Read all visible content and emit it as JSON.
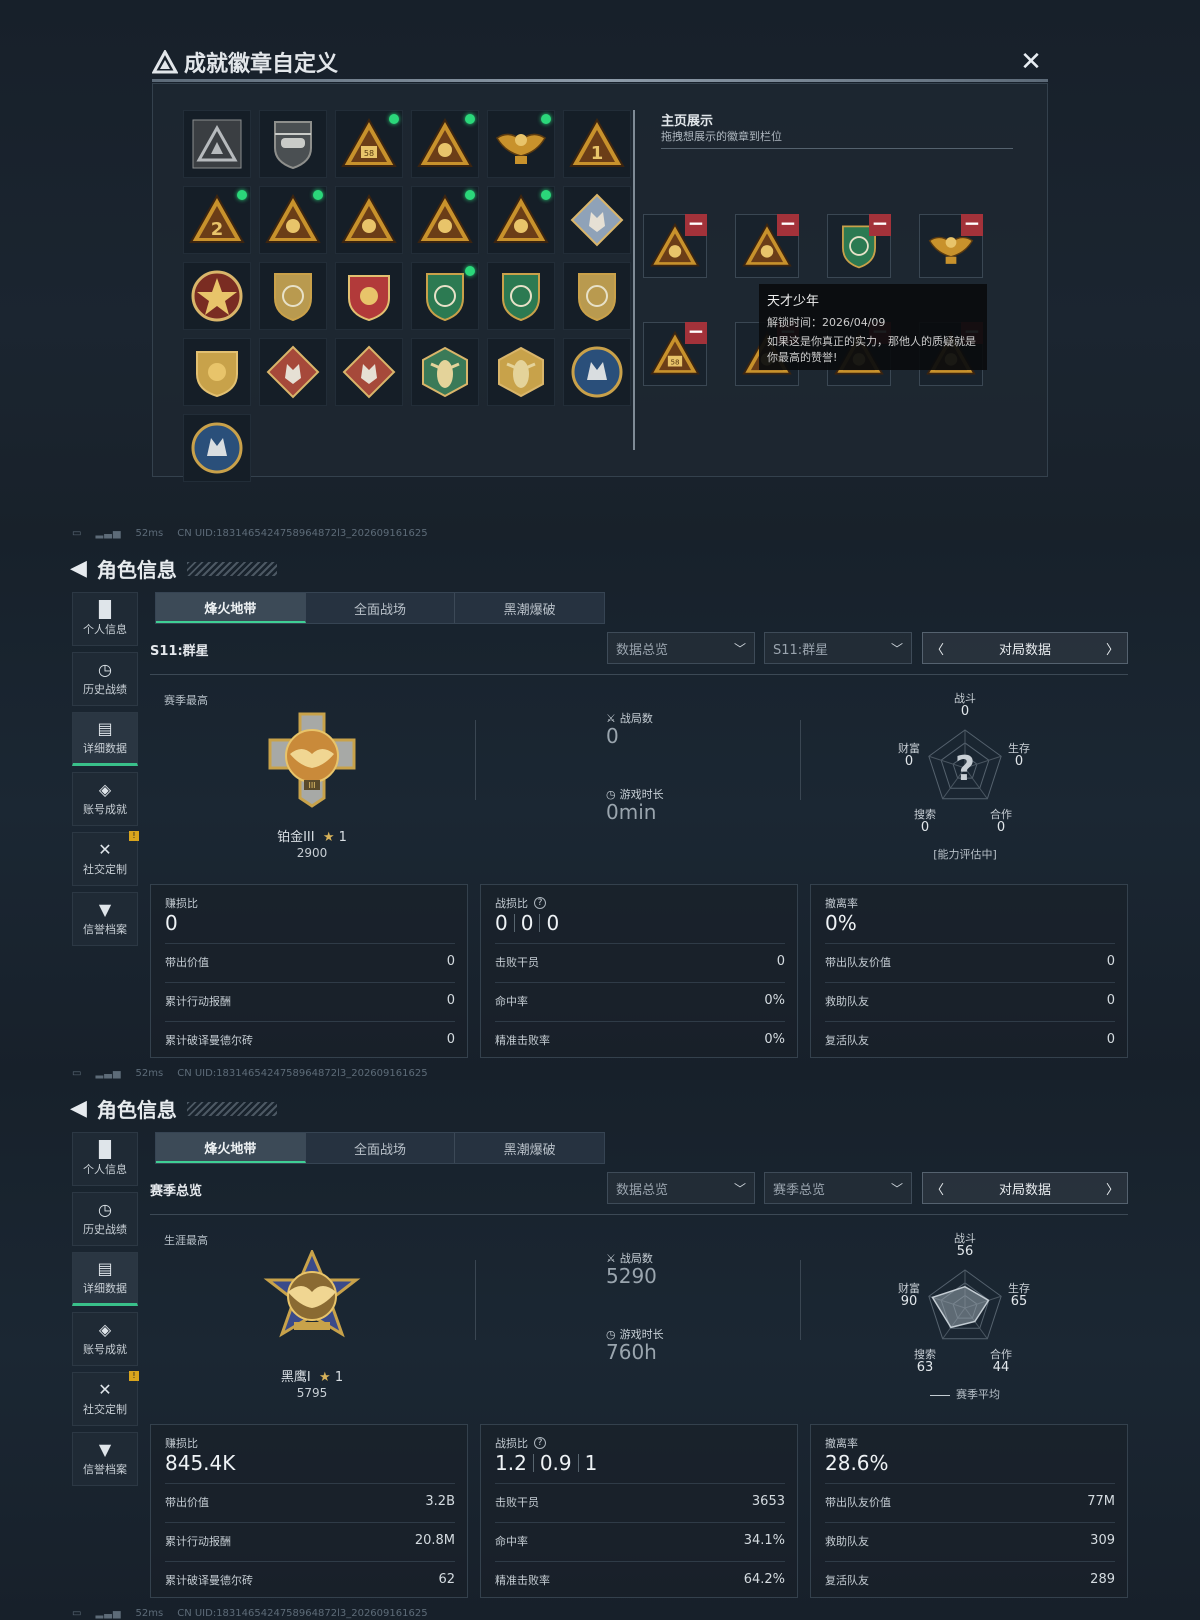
{
  "dialog": {
    "title": "成就徽章自定义",
    "close_icon": "close-icon",
    "showcase_title": "主页展示",
    "showcase_sub": "拖拽想展示的徽章到栏位",
    "badges": [
      {
        "icon": "tri-eye-badge-icon",
        "new": false,
        "color": "#8a8d8f"
      },
      {
        "icon": "helicopter-badge-icon",
        "new": false,
        "color": "#8e8f8c"
      },
      {
        "icon": "tri-58-badge-icon",
        "new": true,
        "color": "#c8922c"
      },
      {
        "icon": "tri-skull-badge-icon",
        "new": true,
        "color": "#c8922c"
      },
      {
        "icon": "eagle-badge-icon",
        "new": true,
        "color": "#c8922c"
      },
      {
        "icon": "tri-1-badge-icon",
        "new": false,
        "color": "#c8922c"
      },
      {
        "icon": "tri-2-badge-icon",
        "new": true,
        "color": "#c8922c"
      },
      {
        "icon": "tri-box-badge-icon",
        "new": true,
        "color": "#c8922c"
      },
      {
        "icon": "tri-soldier-badge-icon",
        "new": false,
        "color": "#c8922c"
      },
      {
        "icon": "tri-rocket-badge-icon",
        "new": true,
        "color": "#c8922c"
      },
      {
        "icon": "tri-wolf-badge-icon",
        "new": true,
        "color": "#c8922c"
      },
      {
        "icon": "diamond-cube-badge-icon",
        "new": false,
        "color": "#8fa2b8"
      },
      {
        "icon": "star-wreath-badge-icon",
        "new": false,
        "color": "#b94a32"
      },
      {
        "icon": "shield-emblem-badge-icon",
        "new": false,
        "color": "#b99a4f"
      },
      {
        "icon": "crest-badge-icon",
        "new": false,
        "color": "#b23a3a"
      },
      {
        "icon": "green-shield-badge-icon",
        "new": true,
        "color": "#2c7a52"
      },
      {
        "icon": "green-rifle-badge-icon",
        "new": false,
        "color": "#2c7a52"
      },
      {
        "icon": "gun-shield-badge-icon",
        "new": false,
        "color": "#b99a4f"
      },
      {
        "icon": "winged-crest-badge-icon",
        "new": false,
        "color": "#c8a24a"
      },
      {
        "icon": "wolf-diamond-badge-icon",
        "new": false,
        "color": "#a6493a"
      },
      {
        "icon": "wolf-diamond2-badge-icon",
        "new": false,
        "color": "#a6493a"
      },
      {
        "icon": "wasp-badge-icon",
        "new": false,
        "color": "#3a7a58"
      },
      {
        "icon": "wasp2-badge-icon",
        "new": false,
        "color": "#c8a24a"
      },
      {
        "icon": "wolf-circle-badge-icon",
        "new": false,
        "color": "#2a4f7a"
      },
      {
        "icon": "wolf-circle2-badge-icon",
        "new": false,
        "color": "#2a4f7a"
      }
    ],
    "slots": [
      {
        "icon": "tri-rocket-badge-icon",
        "color": "#c8922c"
      },
      {
        "icon": "tri-box-badge-icon",
        "color": "#c8922c"
      },
      {
        "icon": "green-shield-badge-icon",
        "color": "#2c7a52"
      },
      {
        "icon": "eagle-badge-icon",
        "color": "#c8922c"
      },
      {
        "icon": "tri-58-badge-icon",
        "color": "#c8922c"
      },
      {
        "icon": "tri-box-badge-icon",
        "color": "#c8922c"
      },
      {
        "icon": "tri-skull-badge-icon",
        "color": "#c8922c"
      },
      {
        "icon": "tri-rocket-badge-icon",
        "color": "#c8922c"
      }
    ],
    "tooltip": {
      "name": "天才少年",
      "time": "解锁时间：2026/04/09",
      "desc": "如果这是你真正的实力，那他人的质疑就是你最高的赞誉!"
    }
  },
  "status": {
    "ping": "52ms",
    "uid": "CN UID:1831465424758964872l3_202609161625"
  },
  "nav_labels": [
    "个人信息",
    "历史战绩",
    "详细数据",
    "账号成就",
    "社交定制",
    "信誉档案"
  ],
  "tabs": [
    "烽火地带",
    "全面战场",
    "黑潮爆破"
  ],
  "panel1": {
    "title": "角色信息",
    "subtitle": "S11:群星",
    "drop1": "数据总览",
    "drop2": "S11:群星",
    "match": "对局数据",
    "best_label": "赛季最高",
    "rank_name": "铂金III",
    "rank_stars": "1",
    "rank_points": "2900",
    "games_label": "战局数",
    "games": "0",
    "time_label": "游戏时长",
    "time": "0min",
    "radar": {
      "combat": "0",
      "survive": "0",
      "coop": "0",
      "search": "0",
      "wealth": "0",
      "note": "[能力评估中]",
      "values": [
        0,
        0,
        0,
        0,
        0
      ],
      "labels": {
        "combat": "战斗",
        "survive": "生存",
        "coop": "合作",
        "search": "搜索",
        "wealth": "财富"
      }
    },
    "cards": [
      {
        "head": "赚损比",
        "value": "0",
        "rows": [
          [
            "带出价值",
            "0"
          ],
          [
            "累计行动报酬",
            "0"
          ],
          [
            "累计破译曼德尔砖",
            "0"
          ]
        ]
      },
      {
        "head": "战损比",
        "values": [
          "0",
          "0",
          "0"
        ],
        "rows": [
          [
            "击败干员",
            "0"
          ],
          [
            "命中率",
            "0%"
          ],
          [
            "精准击败率",
            "0%"
          ]
        ]
      },
      {
        "head": "撤离率",
        "value": "0%",
        "rows": [
          [
            "带出队友价值",
            "0"
          ],
          [
            "救助队友",
            "0"
          ],
          [
            "复活队友",
            "0"
          ]
        ]
      }
    ]
  },
  "panel2": {
    "title": "角色信息",
    "subtitle": "赛季总览",
    "drop1": "数据总览",
    "drop2": "赛季总览",
    "match": "对局数据",
    "best_label": "生涯最高",
    "rank_name": "黑鹰I",
    "rank_stars": "1",
    "rank_points": "5795",
    "games_label": "战局数",
    "games": "5290",
    "time_label": "游戏时长",
    "time": "760h",
    "radar": {
      "combat": "56",
      "survive": "65",
      "coop": "44",
      "search": "63",
      "wealth": "90",
      "note": "赛季平均",
      "values": [
        56,
        65,
        44,
        63,
        90
      ],
      "labels": {
        "combat": "战斗",
        "survive": "生存",
        "coop": "合作",
        "search": "搜索",
        "wealth": "财富"
      }
    },
    "cards": [
      {
        "head": "赚损比",
        "value": "845.4K",
        "rows": [
          [
            "带出价值",
            "3.2B"
          ],
          [
            "累计行动报酬",
            "20.8M"
          ],
          [
            "累计破译曼德尔砖",
            "62"
          ]
        ]
      },
      {
        "head": "战损比",
        "values": [
          "1.2",
          "0.9",
          "1"
        ],
        "rows": [
          [
            "击败干员",
            "3653"
          ],
          [
            "命中率",
            "34.1%"
          ],
          [
            "精准击败率",
            "64.2%"
          ]
        ]
      },
      {
        "head": "撤离率",
        "value": "28.6%",
        "rows": [
          [
            "带出队友价值",
            "77M"
          ],
          [
            "救助队友",
            "309"
          ],
          [
            "复活队友",
            "289"
          ]
        ]
      }
    ]
  }
}
